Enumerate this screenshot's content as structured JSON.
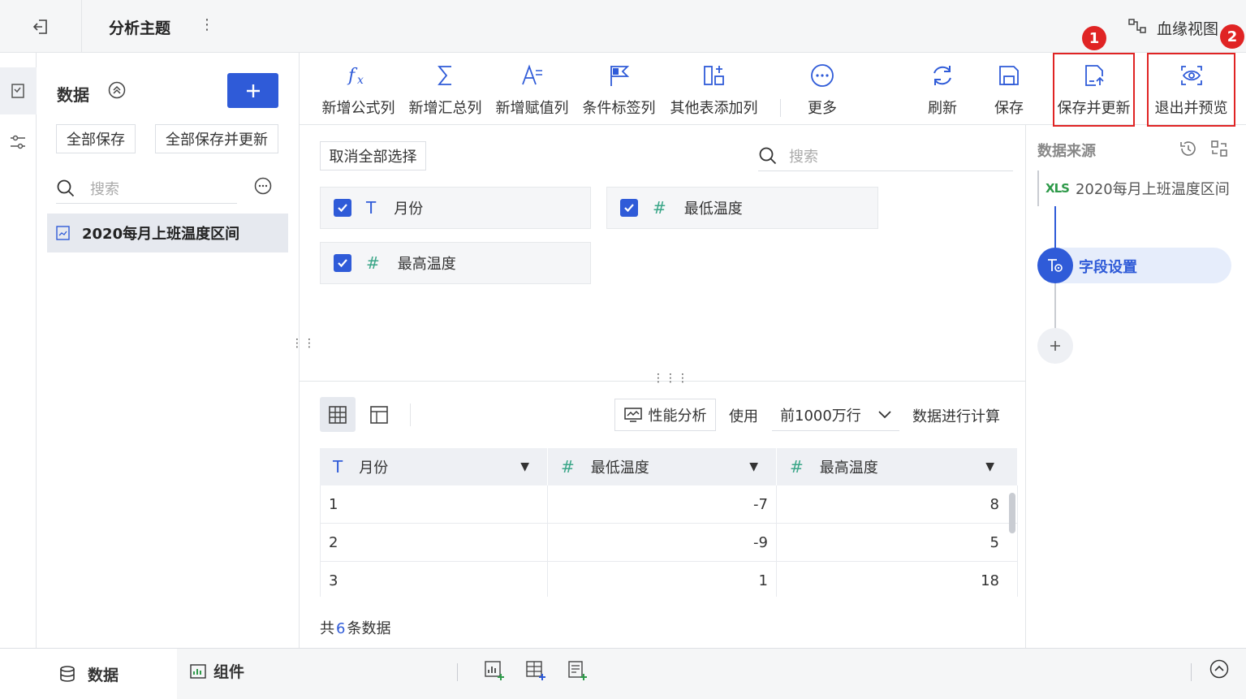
{
  "header": {
    "title": "分析主题",
    "lineage": "血缘视图"
  },
  "left": {
    "title": "数据",
    "save_all": "全部保存",
    "save_all_update": "全部保存并更新",
    "search_placeholder": "搜索",
    "dataset": "2020每月上班温度区间"
  },
  "toolbar": {
    "items": [
      "新增公式列",
      "新增汇总列",
      "新增赋值列",
      "条件标签列",
      "其他表添加列",
      "更多",
      "刷新",
      "保存",
      "保存并更新",
      "退出并预览"
    ]
  },
  "badges": [
    "1",
    "2"
  ],
  "fields": {
    "deselect": "取消全部选择",
    "search_placeholder": "搜索",
    "list": [
      {
        "type": "T",
        "name": "月份"
      },
      {
        "type": "#",
        "name": "最低温度"
      },
      {
        "type": "#",
        "name": "最高温度"
      }
    ]
  },
  "preview": {
    "perf": "性能分析",
    "use": "使用",
    "rows_option": "前1000万行",
    "calc": "数据进行计算",
    "columns": [
      {
        "type": "T",
        "name": "月份"
      },
      {
        "type": "#",
        "name": "最低温度"
      },
      {
        "type": "#",
        "name": "最高温度"
      }
    ],
    "rows": [
      [
        "1",
        "-7",
        "8"
      ],
      [
        "2",
        "-9",
        "5"
      ],
      [
        "3",
        "1",
        "18"
      ]
    ],
    "total_prefix": "共",
    "total_count": "6",
    "total_suffix": "条数据"
  },
  "source": {
    "title": "数据来源",
    "xls": "XLS",
    "dataset": "2020每月上班温度区间",
    "step": "字段设置"
  },
  "bottom": {
    "data_tab": "数据",
    "component_tab": "组件"
  },
  "colors": {
    "accent": "#2f5bd8",
    "red": "#e02424"
  }
}
